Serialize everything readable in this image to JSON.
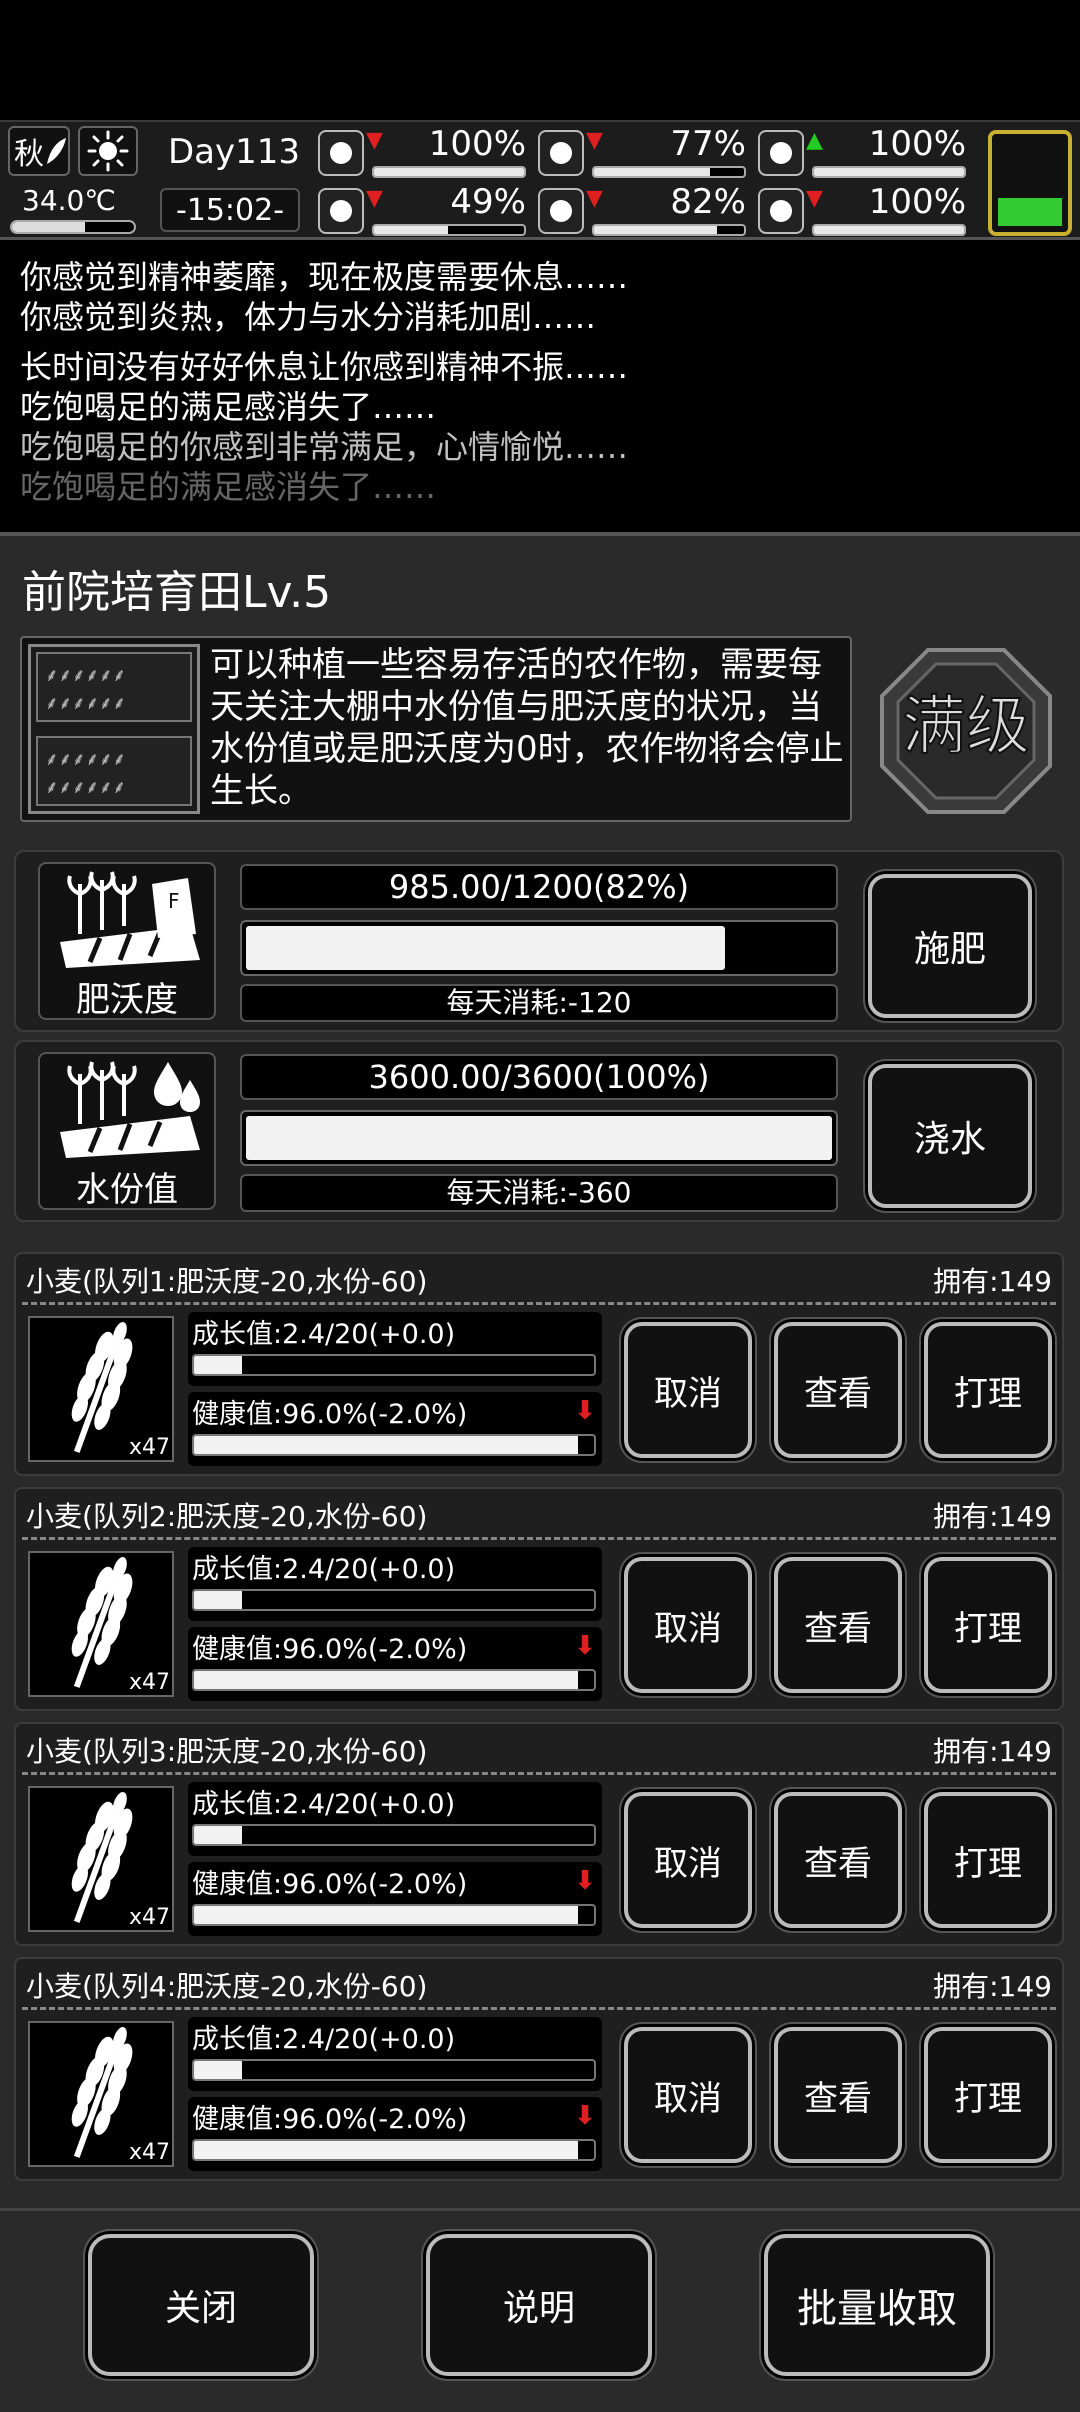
{
  "status": {
    "season": "秋",
    "weather_icon": "sun-icon",
    "temperature": "34.0℃",
    "temperature_level": 0.6,
    "day": "Day113",
    "time": "-15:02-",
    "stats": [
      {
        "name": "health",
        "icon": "medkit-icon",
        "trend": "down",
        "value": "100%",
        "level": 1.0
      },
      {
        "name": "hunger",
        "icon": "stomach-icon",
        "trend": "down",
        "value": "77%",
        "level": 0.77
      },
      {
        "name": "mood",
        "icon": "jar-icon",
        "trend": "up",
        "value": "100%",
        "level": 1.0
      },
      {
        "name": "stamina",
        "icon": "boot-icon",
        "trend": "down",
        "value": "49%",
        "level": 0.49
      },
      {
        "name": "thirst",
        "icon": "water-drop-icon",
        "trend": "down",
        "value": "82%",
        "level": 0.82
      },
      {
        "name": "spirit",
        "icon": "heart-icon",
        "trend": "down",
        "value": "100%",
        "level": 1.0
      }
    ],
    "battery_level": 0.35,
    "colors": {
      "up": "#22cc22",
      "down": "#e02020",
      "battery": "#33cc33"
    }
  },
  "log": [
    "你感觉到精神萎靡，现在极度需要休息……",
    "你感觉到炎热，体力与水分消耗加剧……",
    "长时间没有好好休息让你感到精神不振……",
    "吃饱喝足的满足感消失了……",
    "吃饱喝足的你感到非常满足，心情愉悦……",
    "吃饱喝足的满足感消失了……"
  ],
  "field": {
    "title": "前院培育田Lv.5",
    "description": "可以种植一些容易存活的农作物，需要每天关注大棚中水份值与肥沃度的状况，当水份值或是肥沃度为0时，农作物将会停止生长。",
    "max_badge": "满级"
  },
  "resources": {
    "fertility": {
      "label": "肥沃度",
      "value": "985.00/1200(82%)",
      "level": 0.82,
      "consume": "每天消耗:-120",
      "button": "施肥"
    },
    "water": {
      "label": "水份值",
      "value": "3600.00/3600(100%)",
      "level": 1.0,
      "consume": "每天消耗:-360",
      "button": "浇水"
    }
  },
  "crops": [
    {
      "title": "小麦(队列1:肥沃度-20,水份-60)",
      "owned": "拥有:149",
      "count": "x47",
      "growth": "成长值:2.4/20(+0.0)",
      "growth_level": 0.12,
      "health": "健康值:96.0%(-2.0%)",
      "health_level": 0.96,
      "cancel": "取消",
      "view": "查看",
      "tend": "打理"
    },
    {
      "title": "小麦(队列2:肥沃度-20,水份-60)",
      "owned": "拥有:149",
      "count": "x47",
      "growth": "成长值:2.4/20(+0.0)",
      "growth_level": 0.12,
      "health": "健康值:96.0%(-2.0%)",
      "health_level": 0.96,
      "cancel": "取消",
      "view": "查看",
      "tend": "打理"
    },
    {
      "title": "小麦(队列3:肥沃度-20,水份-60)",
      "owned": "拥有:149",
      "count": "x47",
      "growth": "成长值:2.4/20(+0.0)",
      "growth_level": 0.12,
      "health": "健康值:96.0%(-2.0%)",
      "health_level": 0.96,
      "cancel": "取消",
      "view": "查看",
      "tend": "打理"
    },
    {
      "title": "小麦(队列4:肥沃度-20,水份-60)",
      "owned": "拥有:149",
      "count": "x47",
      "growth": "成长值:2.4/20(+0.0)",
      "growth_level": 0.12,
      "health": "健康值:96.0%(-2.0%)",
      "health_level": 0.96,
      "cancel": "取消",
      "view": "查看",
      "tend": "打理"
    }
  ],
  "footer": {
    "close": "关闭",
    "help": "说明",
    "harvest_all": "批量收取"
  }
}
